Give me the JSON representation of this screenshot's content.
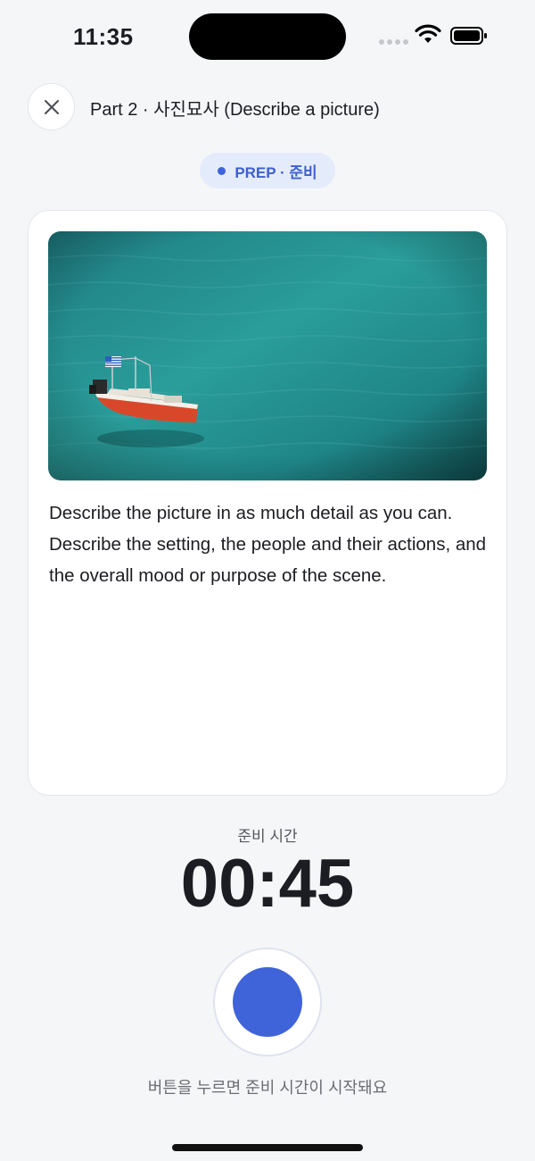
{
  "status_bar": {
    "time": "11:35",
    "icons": [
      "cellular-signal-icon",
      "wifi-icon",
      "battery-icon"
    ]
  },
  "header": {
    "close_icon": "close-icon",
    "title": "Part 2 · 사진묘사 (Describe a picture)"
  },
  "phase_badge": {
    "label": "PREP · 준비",
    "color": "#3d5fcf",
    "background": "#e4ebfb"
  },
  "prompt": {
    "image_alt": "small red and white boat with a Greek flag floating on turquoise water",
    "text": "Describe the picture in as much detail as you can. Describe the setting, the people and their actions, and the overall mood or purpose of the scene."
  },
  "timer": {
    "label": "준비 시간",
    "value": "00:45"
  },
  "start_button": {
    "accent_color": "#3f63d9",
    "hint": "버튼을 누르면 준비 시간이 시작돼요"
  }
}
